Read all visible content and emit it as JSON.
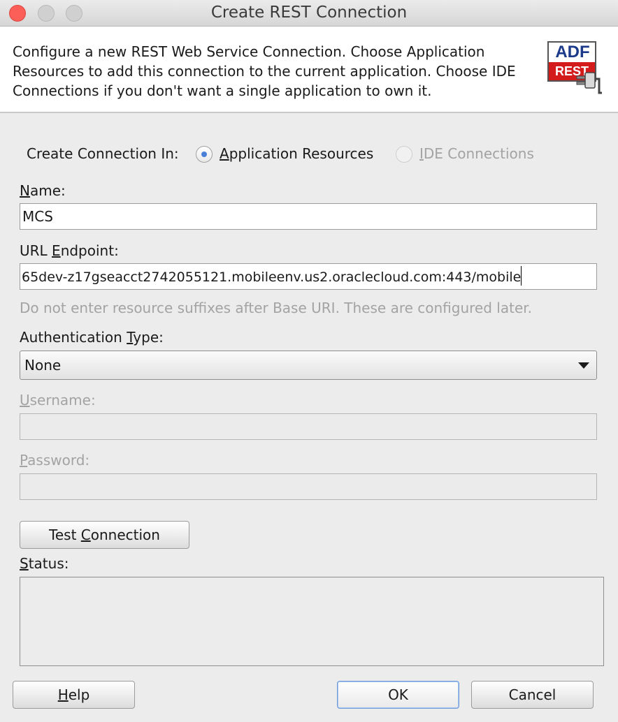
{
  "window": {
    "title": "Create REST Connection"
  },
  "header": {
    "description": "Configure a new REST Web Service Connection. Choose Application Resources to add this connection to the current application. Choose IDE Connections if you don't want a single application to own it.",
    "icon": "adf-rest-connection-icon",
    "icon_top_text": "ADF",
    "icon_bottom_text": "REST"
  },
  "form": {
    "create_in_label": "Create Connection In:",
    "radio_app": {
      "label_rest": "pplication Resources",
      "label_mnemonic": "A",
      "checked": true
    },
    "radio_ide": {
      "label_rest": "DE Connections",
      "label_mnemonic": "I",
      "checked": false
    },
    "name_label_mnemonic": "N",
    "name_label_rest": "ame:",
    "name_value": "MCS",
    "url_label_pre": "URL ",
    "url_label_mnemonic": "E",
    "url_label_rest": "ndpoint:",
    "url_value": "65dev-z17gseacct2742055121.mobileenv.us2.oraclecloud.com:443/mobile",
    "url_hint": "Do not enter resource suffixes after Base URI. These are configured later.",
    "auth_label_pre": "Authentication ",
    "auth_label_mnemonic": "T",
    "auth_label_rest": "ype:",
    "auth_value": "None",
    "username_label_mnemonic": "U",
    "username_label_rest": "sername:",
    "password_label_mnemonic": "P",
    "password_label_rest": "assword:",
    "test_button_pre": "Test ",
    "test_button_mnemonic": "C",
    "test_button_rest": "onnection",
    "status_label_mnemonic": "S",
    "status_label_rest": "tatus:"
  },
  "footer": {
    "help_mnemonic": "H",
    "help_rest": "elp",
    "ok_label": "OK",
    "cancel_label": "Cancel"
  }
}
